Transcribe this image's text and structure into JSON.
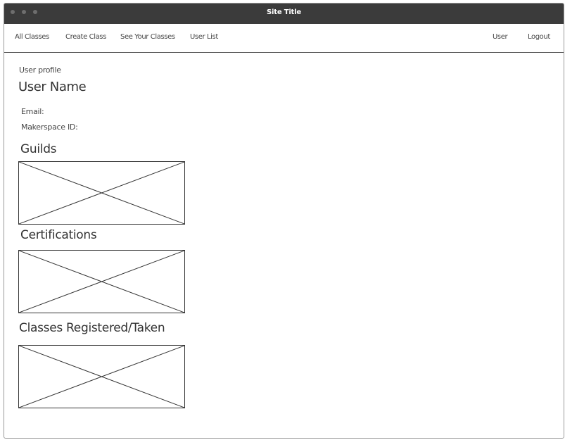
{
  "window": {
    "title": "Site Title"
  },
  "nav": {
    "left_items": [
      "All Classes",
      "Create Class",
      "See Your Classes",
      "User List"
    ],
    "user_label": "User",
    "logout_label": "Logout"
  },
  "profile": {
    "section_label": "User profile",
    "user_name": "User Name",
    "email_label": "Email:",
    "makerspace_label": "Makerspace ID:"
  },
  "sections": {
    "guilds": "Guilds",
    "certifications": "Certifications",
    "classes": "Classes Registered/Taken"
  },
  "colors": {
    "titlebar": "#3b3b3b",
    "border": "#333333"
  }
}
